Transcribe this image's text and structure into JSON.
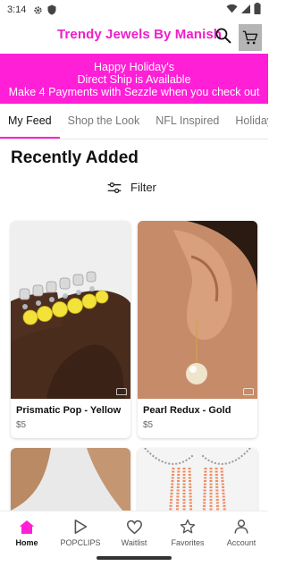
{
  "status_bar": {
    "time": "3:14"
  },
  "header": {
    "title": "Trendy Jewels By Manish"
  },
  "banner": {
    "line1": "Happy Holiday's",
    "line2": "Direct Ship is Available",
    "line3": "Make 4 Payments with Sezzle when you check out"
  },
  "tabs": [
    "My Feed",
    "Shop the Look",
    "NFL Inspired",
    "Holiday"
  ],
  "main": {
    "section_title": "Recently Added",
    "filter_label": "Filter"
  },
  "products": [
    {
      "name": "Prismatic Pop - Yellow",
      "price": "$5"
    },
    {
      "name": "Pearl Redux - Gold",
      "price": "$5"
    }
  ],
  "bottom_nav": [
    {
      "label": "Home",
      "icon": "home-icon"
    },
    {
      "label": "POPCLIPS",
      "icon": "play-icon"
    },
    {
      "label": "Waitlist",
      "icon": "heart-icon"
    },
    {
      "label": "Favorites",
      "icon": "star-icon"
    },
    {
      "label": "Account",
      "icon": "person-icon"
    }
  ],
  "colors": {
    "accent": "#ff1fd7",
    "title": "#ee1fc9",
    "cart_bg": "#b5b5b5"
  }
}
